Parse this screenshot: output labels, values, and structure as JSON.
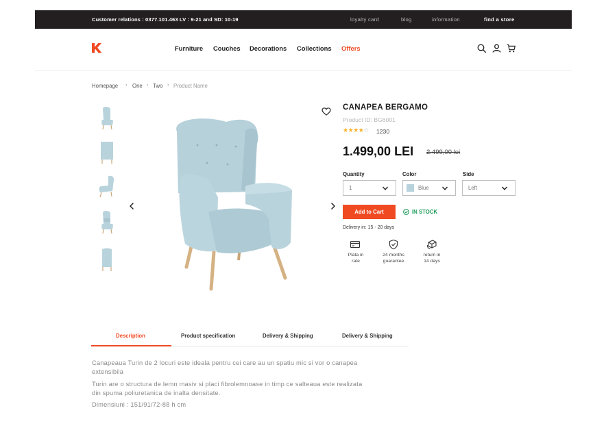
{
  "topbar": {
    "customer_relations": "Customer relations : 0377.101.463 LV : 9-21 and SD: 10-19",
    "links": [
      "loyalty card",
      "blog",
      "information"
    ],
    "find_store": "find a store"
  },
  "header": {
    "logo": "K",
    "nav": [
      "Furniture",
      "Couches",
      "Decorations",
      "Collections"
    ],
    "offers": "Offers",
    "icons": [
      "search-icon",
      "user-icon",
      "cart-icon"
    ]
  },
  "breadcrumb": [
    "Homepage",
    "One",
    "Two",
    "Product Name"
  ],
  "product": {
    "name": "CANAPEA BERGAMO",
    "id": "Product ID: BG6001",
    "rating": 4,
    "rating_max": 5,
    "review_count": "1230",
    "price": "1.499,00 LEI",
    "old_price": "2.499,00 lei"
  },
  "options": {
    "quantity_label": "Quantity",
    "quantity_value": "1",
    "color_label": "Color",
    "color_value": "Blue",
    "color_swatch": "#b8d3dc",
    "side_label": "Side",
    "side_value": "Left"
  },
  "cart": {
    "button": "Add to Cart",
    "stock": "IN STOCK",
    "delivery": "Delivery in: 15 - 20 days"
  },
  "features": [
    {
      "icon": "credit-card-icon",
      "line1": "Plata in",
      "line2": "rate"
    },
    {
      "icon": "shield-check-icon",
      "line1": "24 months",
      "line2": "guarantee"
    },
    {
      "icon": "box-return-icon",
      "line1": "return in",
      "line2": "14 days"
    }
  ],
  "tabs": [
    "Description",
    "Product specification",
    "Delivery & Shipping",
    "Delivery & Shipping"
  ],
  "description": [
    "Canapeaua Turin de 2 locuri este ideala pentru cei care au un spatiu mic si vor o canapea extensibila",
    "Turin are o structura de lemn masiv si placi fibrolemnoase in timp ce salteaua este realizata din spuma poliuretanica de inalta densitate.",
    "Dimensiuni : 151/91/72-88 h cm"
  ],
  "colors": {
    "accent": "#f04a23",
    "topbar": "#231f20",
    "stock": "#1d9b5a",
    "chair": "#b8d3dc"
  }
}
